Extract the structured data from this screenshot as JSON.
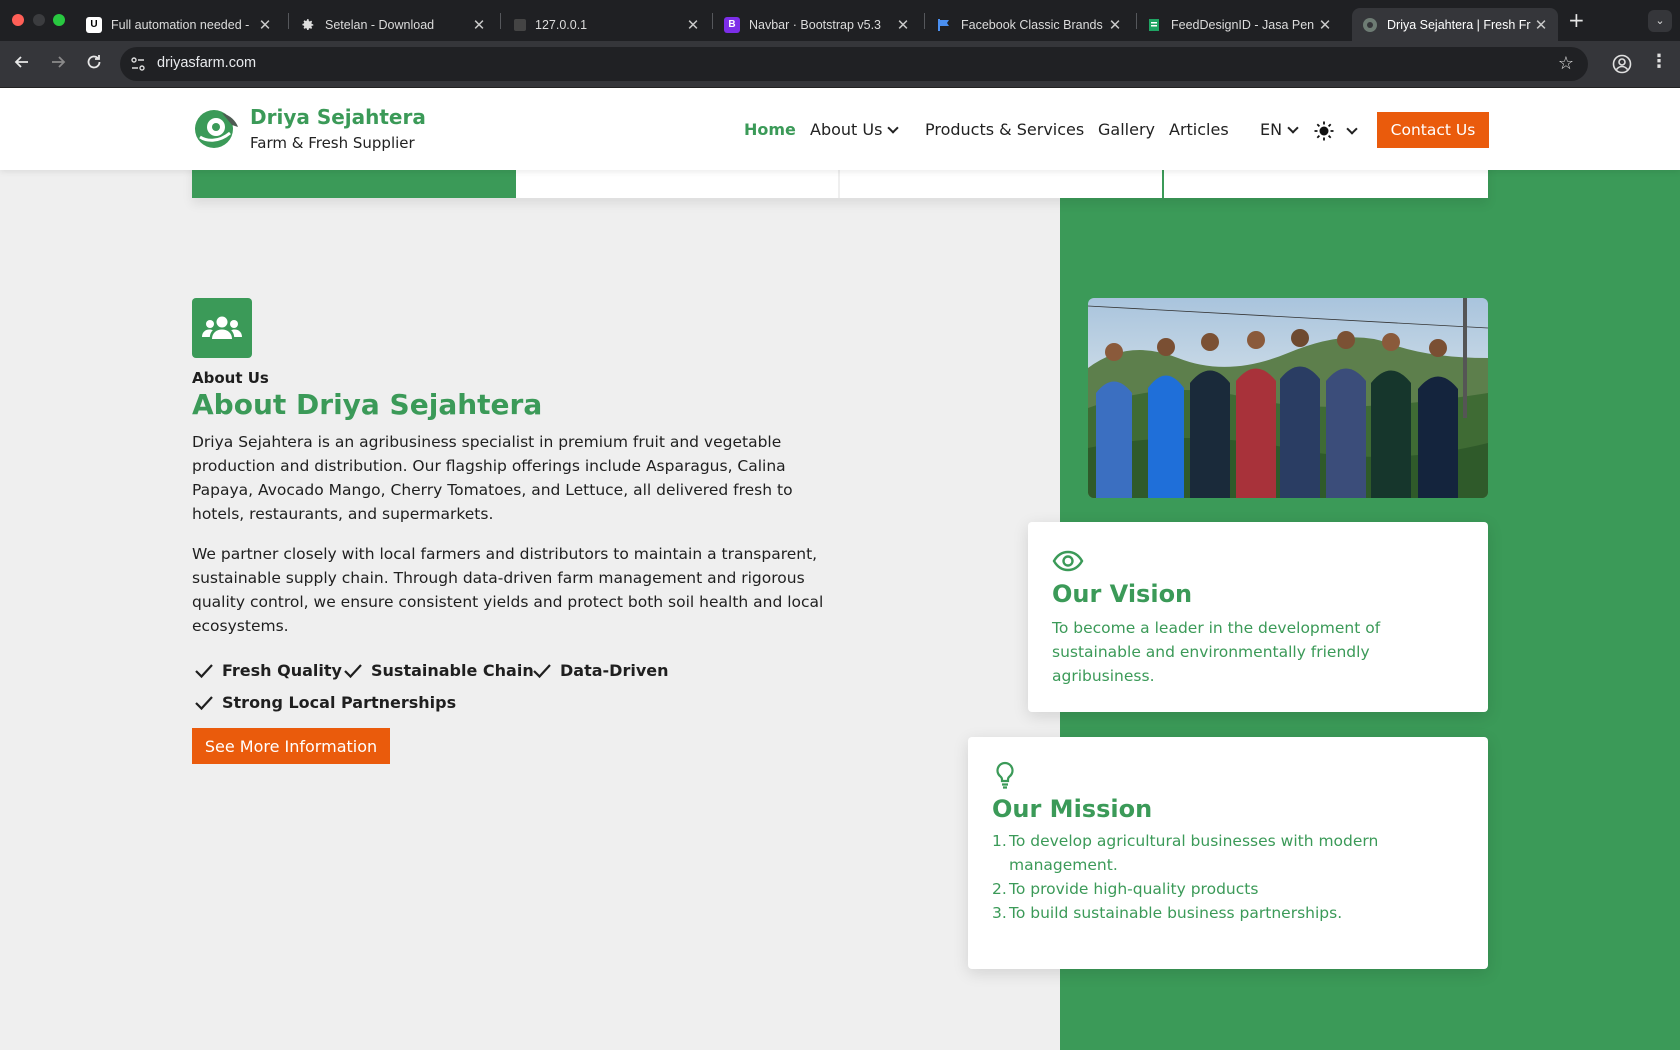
{
  "browser": {
    "tabs": [
      {
        "title": "Full automation needed -",
        "favicon": "upwork-icon"
      },
      {
        "title": "Setelan - Download",
        "favicon": "gear-icon"
      },
      {
        "title": "127.0.0.1",
        "favicon": "page-icon"
      },
      {
        "title": "Navbar · Bootstrap v5.3",
        "favicon": "bootstrap-icon"
      },
      {
        "title": "Facebook Classic Brands",
        "favicon": "flag-icon"
      },
      {
        "title": "FeedDesignID - Jasa Pen",
        "favicon": "sheet-icon"
      },
      {
        "title": "Driya Sejahtera | Fresh Fr",
        "favicon": "driya-icon",
        "active": true
      }
    ],
    "new_tab": "+",
    "url": "driyasfarm.com"
  },
  "header": {
    "brand_name": "Driya Sejahtera",
    "brand_tagline": "Farm & Fresh Supplier",
    "nav": {
      "home": "Home",
      "about": "About Us",
      "products": "Products & Services",
      "gallery": "Gallery",
      "articles": "Articles",
      "lang": "EN"
    },
    "contact": "Contact Us"
  },
  "about": {
    "eyebrow": "About Us",
    "title": "About Driya Sejahtera",
    "paragraph1": "Driya Sejahtera is an agribusiness specialist in premium fruit and vegetable production and distribution. Our flagship offerings include Asparagus, Calina Papaya, Avocado Mango, Cherry Tomatoes, and Lettuce, all delivered fresh to hotels, restaurants, and supermarkets.",
    "paragraph2": "We partner closely with local farmers and distributors to maintain a transparent, sustainable supply chain. Through data-driven farm management and rigorous quality control, we ensure consistent yields and protect both soil health and local ecosystems.",
    "features": [
      "Fresh Quality",
      "Sustainable Chain",
      "Data-Driven",
      "Strong Local Partnerships"
    ],
    "cta": "See More Information"
  },
  "vision": {
    "title": "Our Vision",
    "text": "To become a leader in the development of sustainable and environmentally friendly agribusiness."
  },
  "mission": {
    "title": "Our Mission",
    "items": [
      {
        "num": "1.",
        "text": "To develop agricultural businesses with modern management."
      },
      {
        "num": "2.",
        "text": "To provide high-quality products"
      },
      {
        "num": "3.",
        "text": "To build sustainable business partnerships."
      }
    ]
  },
  "colors": {
    "brand_green": "#3b9a58",
    "accent_orange": "#ea5b0c"
  }
}
